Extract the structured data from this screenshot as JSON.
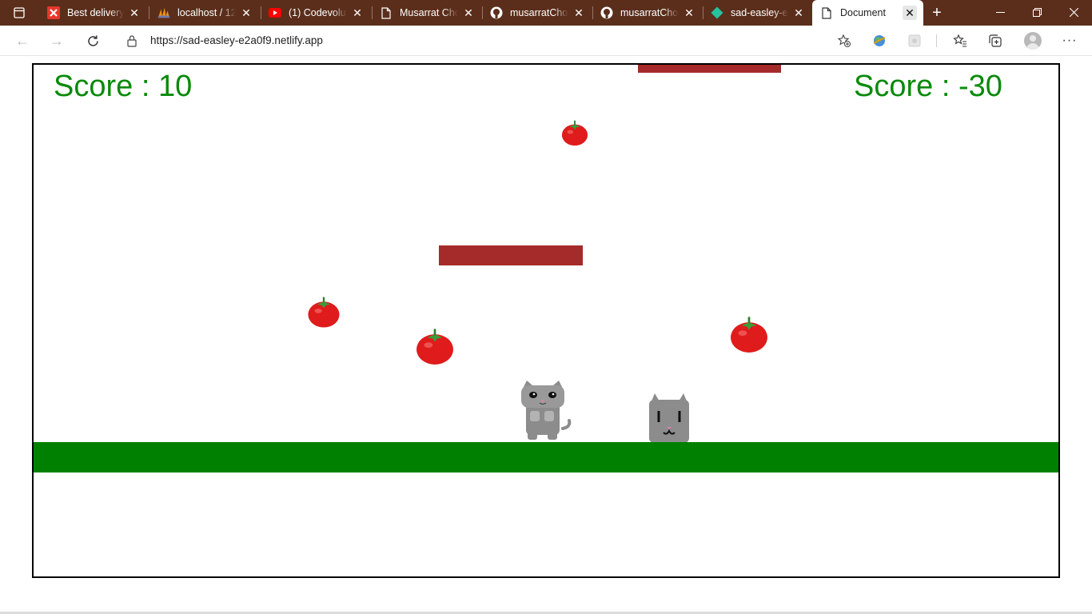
{
  "browser": {
    "tabs": [
      {
        "title": "Best delivery s",
        "favicon": "x-brand-icon",
        "color": "#e8372c",
        "active": false
      },
      {
        "title": "localhost / 12",
        "favicon": "phpmyadmin-icon",
        "color": "#f29111",
        "active": false
      },
      {
        "title": "(1) Codevoluti",
        "favicon": "youtube-icon",
        "color": "#ff0000",
        "active": false
      },
      {
        "title": "Musarrat Cho",
        "favicon": "page-icon",
        "color": "#ffffff",
        "active": false
      },
      {
        "title": "musarratChow",
        "favicon": "github-icon",
        "color": "#ffffff",
        "active": false
      },
      {
        "title": "musarratChow",
        "favicon": "github-icon",
        "color": "#ffffff",
        "active": false
      },
      {
        "title": "sad-easley-e2",
        "favicon": "netlify-icon",
        "color": "#25c2a0",
        "active": false
      },
      {
        "title": "Document",
        "favicon": "page-icon",
        "color": "#333333",
        "active": true
      }
    ],
    "url": "https://sad-easley-e2a0f9.netlify.app"
  },
  "game": {
    "score_left": "Score : 10",
    "score_right": "Score : -30",
    "colors": {
      "score": "#0a8a0a",
      "platform": "#a52a2a",
      "ground": "#008000",
      "tomato": "#e01b1b",
      "cat": "#8c8c8c"
    }
  }
}
